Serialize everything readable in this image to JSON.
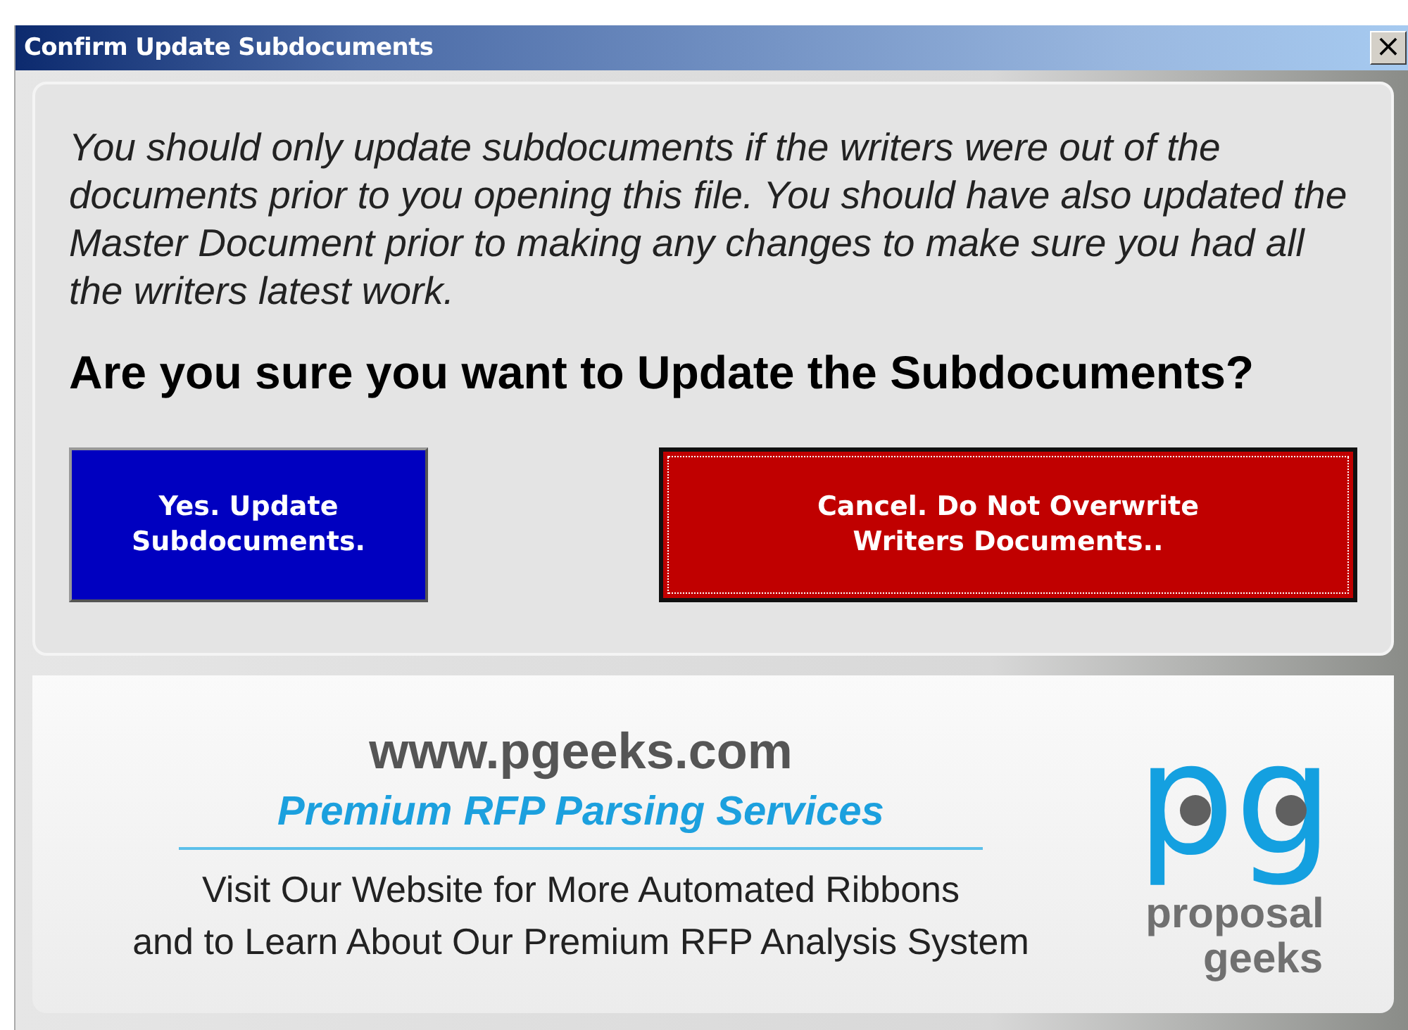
{
  "window": {
    "title": "Confirm Update Subdocuments",
    "close": "×"
  },
  "message": "You should only update subdocuments if the writers were out of the documents prior to you opening this file. You should have also updated the Master Document prior to making any changes to make sure you had all the writers latest work.",
  "question": "Are you sure you want to Update the Subdocuments?",
  "buttons": [
    {
      "label": "Yes. Update\nSubdocuments.",
      "kind": "confirm",
      "color": "#0000c0",
      "focused": false
    },
    {
      "label": "Cancel. Do Not Overwrite\nWriters Documents..",
      "kind": "cancel",
      "color": "#c00000",
      "focused": true
    }
  ],
  "banner": {
    "url": "www.pgeeks.com",
    "tagline": "Premium RFP Parsing Services",
    "text": "Visit Our Website for More Automated Ribbons\nand to Learn About Our Premium RFP Analysis System",
    "logo": {
      "mark": "pg",
      "line1": "proposal",
      "line2": "geeks"
    }
  }
}
